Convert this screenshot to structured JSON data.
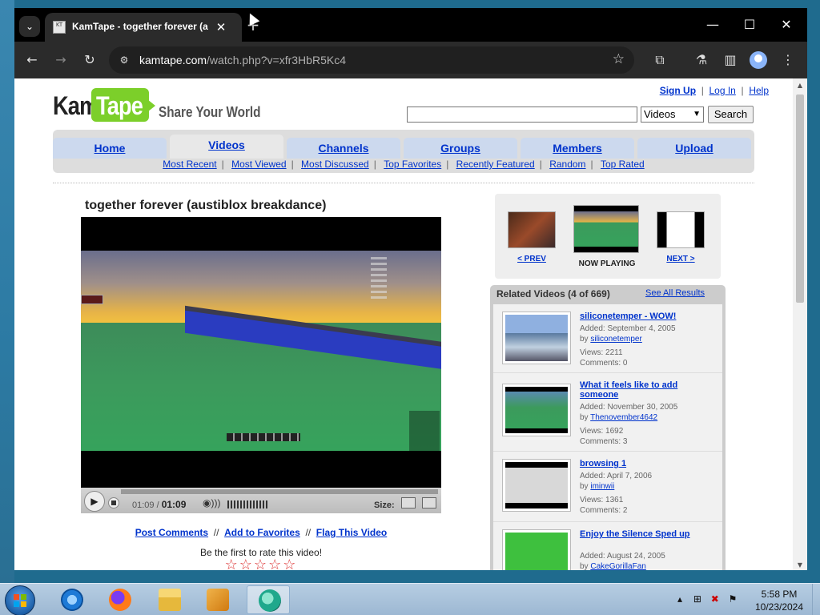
{
  "browser": {
    "tab_title": "KamTape - together forever (austiblox breakdance)",
    "tab_close": "✕",
    "new_tab": "+",
    "url_domain": "kamtape.com",
    "url_path": "/watch.php?v=xfr3HbR5Kc4",
    "window_controls": [
      "—",
      "☐",
      "✕"
    ]
  },
  "site": {
    "logo_kam": "Kam",
    "logo_tape": "Tape",
    "tagline": "Share Your World",
    "top_links": [
      "Sign Up",
      "Log In",
      "Help"
    ],
    "search_placeholder": "",
    "search_category": "Videos",
    "search_button": "Search",
    "nav_tabs": [
      "Home",
      "Videos",
      "Channels",
      "Groups",
      "Members",
      "Upload"
    ],
    "active_tab": "Videos",
    "sub_nav": [
      "Most Recent",
      "Most Viewed",
      "Most Discussed",
      "Top Favorites",
      "Recently Featured",
      "Random",
      "Top Rated"
    ]
  },
  "video": {
    "title": "together forever (austiblox breakdance)",
    "time_current": "01:09",
    "time_total": "01:09",
    "size_label": "Size:",
    "actions": [
      "Post Comments",
      "Add to Favorites",
      "Flag This Video"
    ],
    "rate_prompt": "Be the first to rate this video!",
    "stars": "☆☆☆☆☆"
  },
  "navigator": {
    "prev": "< PREV",
    "now_playing": "NOW PLAYING",
    "next": "NEXT >"
  },
  "related": {
    "title": "Related Videos (4 of 669)",
    "see_all": "See All Results",
    "items": [
      {
        "title": "siliconetemper - WOW!",
        "added": "Added: September 4, 2005",
        "by_label": "by",
        "author": "siliconetemper",
        "views": "Views: 2211",
        "comments": "Comments: 0"
      },
      {
        "title": "What it feels like to add someone",
        "added": "Added: November 30, 2005",
        "by_label": "by",
        "author": "Thenovember4642",
        "views": "Views: 1692",
        "comments": "Comments: 3"
      },
      {
        "title": "browsing 1",
        "added": "Added: April 7, 2006",
        "by_label": "by",
        "author": "iminwii",
        "views": "Views: 1361",
        "comments": "Comments: 2"
      },
      {
        "title": "Enjoy the Silence Sped up",
        "added": "Added: August 24, 2005",
        "by_label": "by",
        "author": "CakeGorillaFan",
        "views": "",
        "comments": ""
      }
    ]
  },
  "taskbar": {
    "time": "5:58 PM",
    "date": "10/23/2024"
  }
}
